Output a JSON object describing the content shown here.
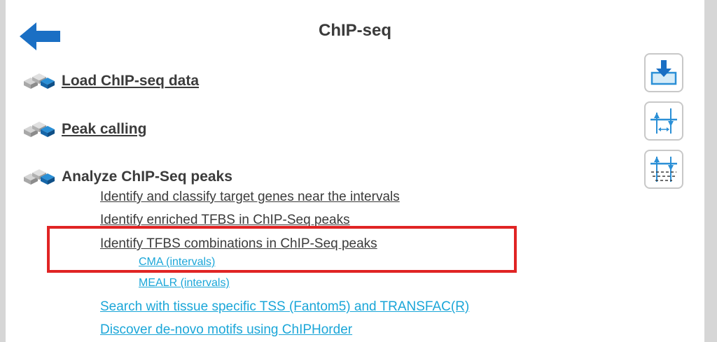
{
  "header": {
    "title": "ChIP-seq"
  },
  "sections": {
    "load": {
      "label": "Load ChIP-seq data"
    },
    "peak": {
      "label": "Peak calling"
    },
    "analyze": {
      "label": "Analyze ChIP-Seq peaks"
    }
  },
  "analyze_items": {
    "identify_classify": "Identify and classify target genes near the intervals",
    "identify_enriched": "Identify enriched TFBS in ChIP-Seq peaks",
    "identify_combinations": "Identify TFBS combinations in ChIP-Seq peaks",
    "cma": "CMA (intervals)",
    "mealr": "MEALR (intervals)",
    "search_tss": "Search with tissue specific TSS (Fantom5) and TRANSFAC(R)",
    "discover_motifs": "Discover de-novo motifs using ChIPHorder"
  },
  "toolbar": {
    "import_icon": "import-icon",
    "interval-icon": "interval-icon",
    "peaks-icon": "peaks-icon"
  },
  "colors": {
    "accent_blue": "#1ba6d8",
    "arrow_blue": "#1a6fc4",
    "highlight_red": "#e02424",
    "text_gray": "#3b3b3b"
  }
}
